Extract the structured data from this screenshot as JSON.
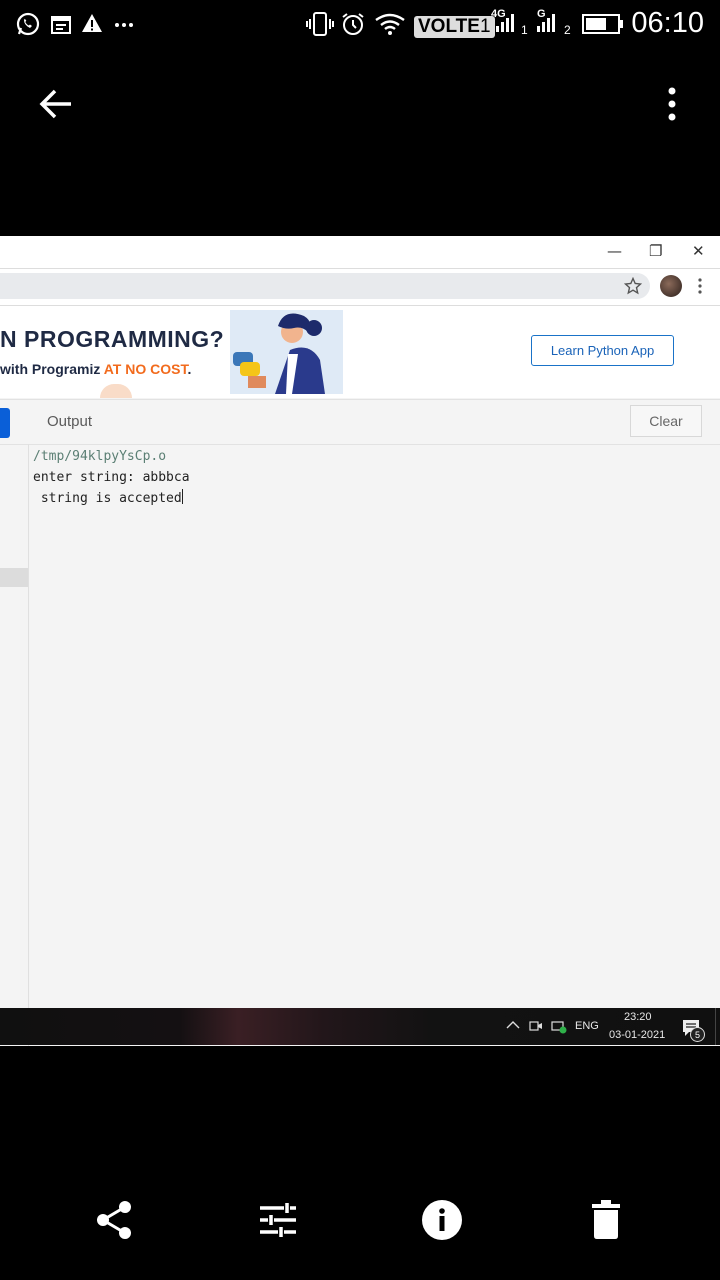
{
  "status_bar": {
    "network_volte": "VOLTE",
    "sim1_label": "1",
    "sim1_type": "4G",
    "sim2_label": "2",
    "sim2_type": "G",
    "time": "06:10",
    "icons": [
      "whatsapp-icon",
      "calendar-icon",
      "warning-icon",
      "more-notifications-icon",
      "vibrate-icon",
      "alarm-icon",
      "wifi-icon",
      "signal-icon",
      "battery-icon"
    ]
  },
  "app_bar": {
    "icons": [
      "back-arrow-icon",
      "overflow-menu-icon"
    ]
  },
  "screenshot": {
    "window_controls": {
      "minimize": "—",
      "restore": "❐",
      "close": "✕"
    },
    "banner": {
      "title": "N PROGRAMMING?",
      "subtitle_prefix": "with Programiz ",
      "subtitle_accent": "AT NO COST",
      "subtitle_suffix": ".",
      "cta": "Learn Python App",
      "accent_color": "#f26b1d"
    },
    "output_panel": {
      "label": "Output",
      "clear_button": "Clear",
      "lines": {
        "path": "/tmp/94klpyYsCp.o",
        "prompt": "enter string: abbbca",
        "result": " string is accepted"
      }
    },
    "taskbar": {
      "language": "ENG",
      "time": "23:20",
      "date": "03-01-2021",
      "notification_count": "5"
    }
  },
  "bottom_toolbar": {
    "icons": [
      "share-icon",
      "edit-adjust-icon",
      "info-icon",
      "delete-icon"
    ]
  }
}
